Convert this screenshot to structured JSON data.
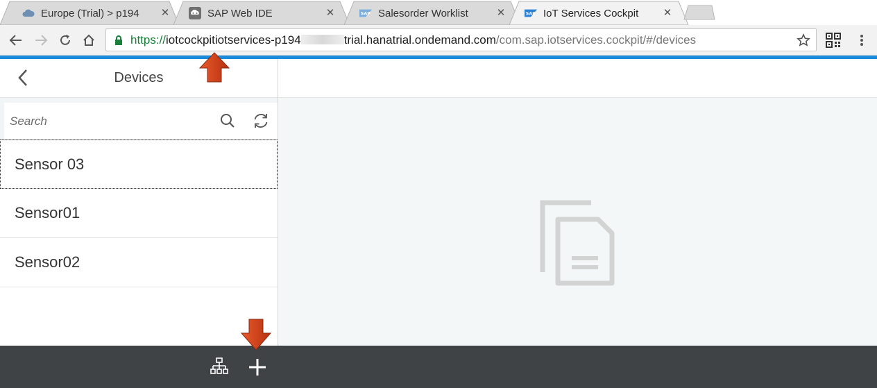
{
  "browser": {
    "tabs": [
      {
        "title": "Europe (Trial) > p194",
        "icon": "cloud-icon",
        "active": false
      },
      {
        "title": "SAP Web IDE",
        "icon": "web-ide-icon",
        "active": false
      },
      {
        "title": "Salesorder Worklist",
        "icon": "sap-logo-icon",
        "active": false
      },
      {
        "title": "IoT Services Cockpit",
        "icon": "sap-logo-icon",
        "active": true
      }
    ],
    "url": {
      "scheme": "https://",
      "host_start": "iotcockpitiotservices-p194",
      "host_end": "trial.hanatrial.ondemand.com",
      "path": "/com.sap.iotservices.cockpit/#/devices"
    }
  },
  "master": {
    "title": "Devices",
    "search_placeholder": "Search",
    "devices": [
      "Sensor 03",
      "Sensor01",
      "Sensor02"
    ]
  },
  "colors": {
    "accent_bar": "#1a8bdb",
    "footer": "#3f4346",
    "annotation_arrow": "#d9411e"
  }
}
